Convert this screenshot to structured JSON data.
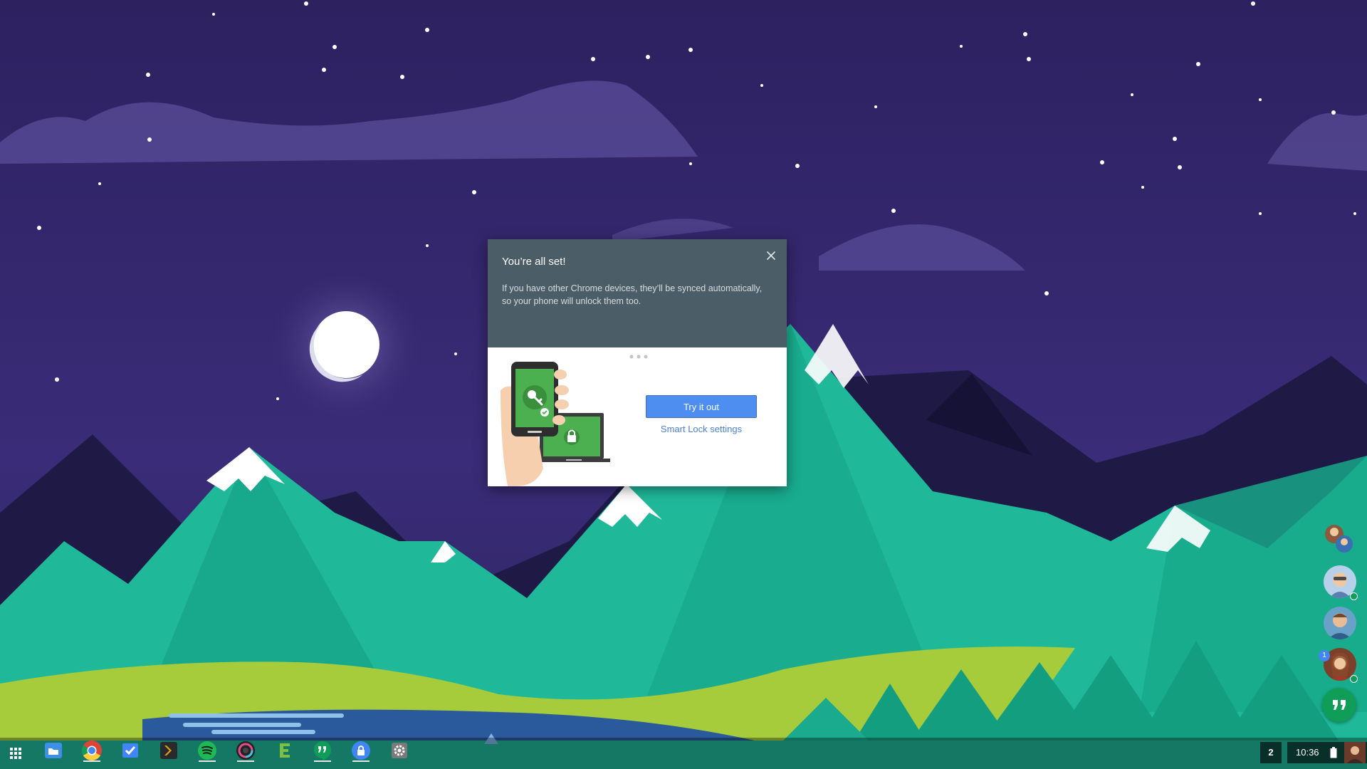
{
  "dialog": {
    "title": "You’re all set!",
    "body": "If you have other Chrome devices, they’ll be synced automatically, so your phone will unlock them too.",
    "primary_button": "Try it out",
    "secondary_link": "Smart Lock settings",
    "close_icon": "close-icon",
    "header_color": "#4b5d66",
    "button_color": "#4d8ef0"
  },
  "shelf": {
    "apps": [
      {
        "name": "app-launcher",
        "icon": "grid-icon"
      },
      {
        "name": "files",
        "icon": "folder-icon"
      },
      {
        "name": "chrome",
        "icon": "chrome-icon"
      },
      {
        "name": "inbox",
        "icon": "inbox-icon"
      },
      {
        "name": "plex",
        "icon": "plex-icon"
      },
      {
        "name": "spotify",
        "icon": "spotify-icon"
      },
      {
        "name": "camera",
        "icon": "camera-icon"
      },
      {
        "name": "evernote",
        "icon": "e-icon"
      },
      {
        "name": "hangouts",
        "icon": "hangouts-icon"
      },
      {
        "name": "lock",
        "icon": "lock-icon"
      },
      {
        "name": "settings",
        "icon": "gear-icon"
      }
    ],
    "notification_count": "2",
    "clock": "10:36"
  },
  "chat_heads": {
    "unread_count": "1"
  },
  "colors": {
    "sky": "#2b2160",
    "mountain_green": "#1fb99a",
    "grass": "#a6cc3b",
    "lake": "#2a5a9c"
  }
}
